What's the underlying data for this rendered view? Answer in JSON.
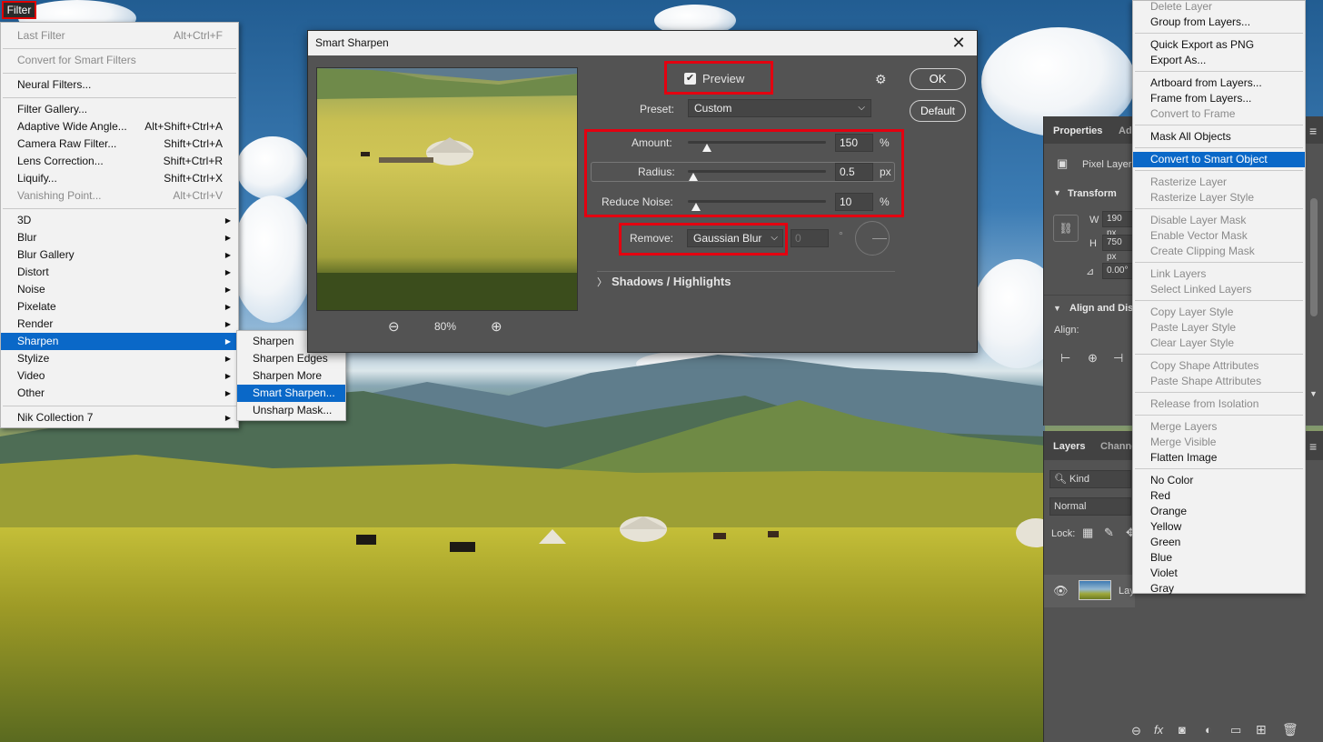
{
  "filter_menu": {
    "title": "Filter",
    "items": [
      {
        "label": "Last Filter",
        "shortcut": "Alt+Ctrl+F"
      },
      {
        "label": "Convert for Smart Filters",
        "shortcut": ""
      },
      {
        "label": "Neural Filters...",
        "shortcut": ""
      },
      {
        "label": "Filter Gallery...",
        "shortcut": ""
      },
      {
        "label": "Adaptive Wide Angle...",
        "shortcut": "Alt+Shift+Ctrl+A"
      },
      {
        "label": "Camera Raw Filter...",
        "shortcut": "Shift+Ctrl+A"
      },
      {
        "label": "Lens Correction...",
        "shortcut": "Shift+Ctrl+R"
      },
      {
        "label": "Liquify...",
        "shortcut": "Shift+Ctrl+X"
      },
      {
        "label": "Vanishing Point...",
        "shortcut": "Alt+Ctrl+V"
      },
      {
        "label": "3D"
      },
      {
        "label": "Blur"
      },
      {
        "label": "Blur Gallery"
      },
      {
        "label": "Distort"
      },
      {
        "label": "Noise"
      },
      {
        "label": "Pixelate"
      },
      {
        "label": "Render"
      },
      {
        "label": "Sharpen"
      },
      {
        "label": "Stylize"
      },
      {
        "label": "Video"
      },
      {
        "label": "Other"
      },
      {
        "label": "Nik Collection 7"
      }
    ]
  },
  "sharpen_submenu": {
    "items": [
      "Sharpen",
      "Sharpen Edges",
      "Sharpen More",
      "Smart Sharpen...",
      "Unsharp Mask..."
    ]
  },
  "smart_sharpen": {
    "title": "Smart Sharpen",
    "close": "✕",
    "preview_label": "Preview",
    "preset_label": "Preset:",
    "preset_value": "Custom",
    "ok_label": "OK",
    "default_label": "Default",
    "zoom": "80%",
    "amount": {
      "label": "Amount:",
      "value": "150",
      "unit": "%",
      "slider_fraction": 0.14
    },
    "radius": {
      "label": "Radius:",
      "value": "0.5",
      "unit": "px",
      "slider_fraction": 0.04
    },
    "reduce_noise": {
      "label": "Reduce Noise:",
      "value": "10",
      "unit": "%",
      "slider_fraction": 0.06
    },
    "remove_label": "Remove:",
    "remove_value": "Gaussian Blur",
    "angle_value": "0",
    "angle_unit": "°",
    "shadows_highlights": "Shadows / Highlights"
  },
  "properties_panel": {
    "tab1": "Properties",
    "tab2": "Ad",
    "layer_type": "Pixel Layer",
    "transform_label": "Transform",
    "w_label": "W",
    "w_value": "190 px",
    "h_label": "H",
    "h_value": "750 px",
    "angle_value": "0.00°",
    "align_label": "Align and Dis",
    "align_sub": "Align:"
  },
  "layers_panel": {
    "tab1": "Layers",
    "tab2": "Channe",
    "kind": "Kind",
    "blend": "Normal",
    "lock_label": "Lock:",
    "layer_name": "Lay"
  },
  "context_menu": {
    "items": [
      {
        "label": "Delete Layer",
        "disabled": true
      },
      {
        "label": "Group from Layers...",
        "disabled": false
      },
      {
        "label": "Quick Export as PNG",
        "disabled": false
      },
      {
        "label": "Export As...",
        "disabled": false
      },
      {
        "label": "Artboard from Layers...",
        "disabled": false
      },
      {
        "label": "Frame from Layers...",
        "disabled": false
      },
      {
        "label": "Convert to Frame",
        "disabled": true
      },
      {
        "label": "Mask All Objects",
        "disabled": false
      },
      {
        "label": "Convert to Smart Object",
        "disabled": false
      },
      {
        "label": "Rasterize Layer",
        "disabled": true
      },
      {
        "label": "Rasterize Layer Style",
        "disabled": true
      },
      {
        "label": "Disable Layer Mask",
        "disabled": true
      },
      {
        "label": "Enable Vector Mask",
        "disabled": true
      },
      {
        "label": "Create Clipping Mask",
        "disabled": true
      },
      {
        "label": "Link Layers",
        "disabled": true
      },
      {
        "label": "Select Linked Layers",
        "disabled": true
      },
      {
        "label": "Copy Layer Style",
        "disabled": true
      },
      {
        "label": "Paste Layer Style",
        "disabled": true
      },
      {
        "label": "Clear Layer Style",
        "disabled": true
      },
      {
        "label": "Copy Shape Attributes",
        "disabled": true
      },
      {
        "label": "Paste Shape Attributes",
        "disabled": true
      },
      {
        "label": "Release from Isolation",
        "disabled": true
      },
      {
        "label": "Merge Layers",
        "disabled": true
      },
      {
        "label": "Merge Visible",
        "disabled": true
      },
      {
        "label": "Flatten Image",
        "disabled": false
      },
      {
        "label": "No Color",
        "disabled": false
      },
      {
        "label": "Red",
        "disabled": false
      },
      {
        "label": "Orange",
        "disabled": false
      },
      {
        "label": "Yellow",
        "disabled": false
      },
      {
        "label": "Green",
        "disabled": false
      },
      {
        "label": "Blue",
        "disabled": false
      },
      {
        "label": "Violet",
        "disabled": false
      },
      {
        "label": "Gray",
        "disabled": false
      }
    ]
  },
  "colors": {
    "highlight": "#0a68c8",
    "annotation_red": "#e30010",
    "panel_bg": "#535353"
  }
}
